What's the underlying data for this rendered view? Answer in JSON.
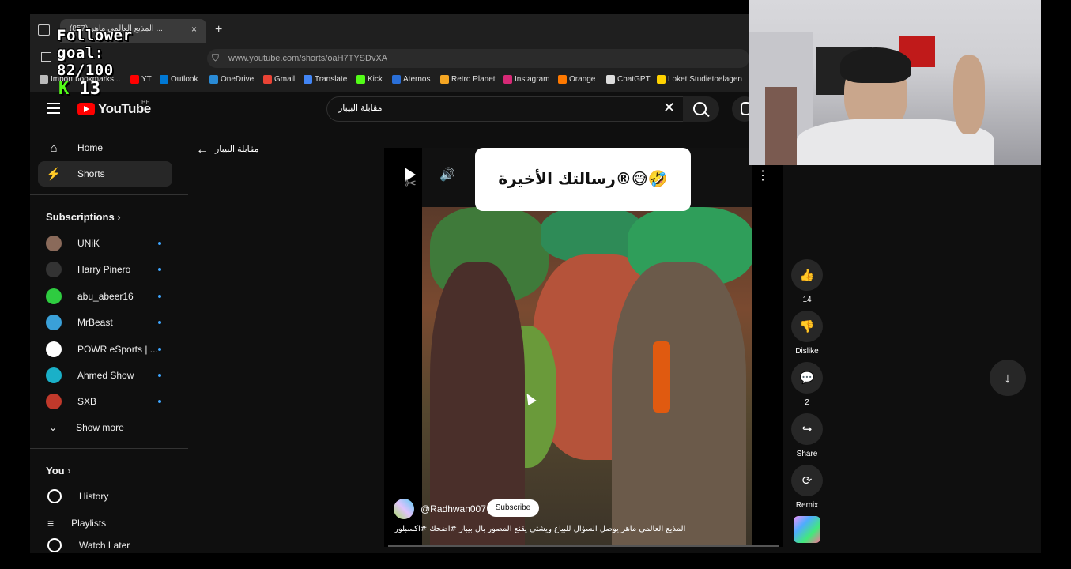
{
  "browser": {
    "tab_title": "(857) المذيع العالمي ماهر ...",
    "new_tab": "+",
    "tab_close": "×",
    "url": "www.youtube.com/shorts/oaH7TYSDvXA",
    "bookmarks": [
      {
        "label": "Import bookmarks...",
        "color": "#bbbbbb"
      },
      {
        "label": "YT",
        "color": "#ff0000"
      },
      {
        "label": "Outlook",
        "color": "#0078d4"
      },
      {
        "label": "OneDrive",
        "color": "#2a8bd6"
      },
      {
        "label": "Gmail",
        "color": "#ea4335"
      },
      {
        "label": "Translate",
        "color": "#4285f4"
      },
      {
        "label": "Kick",
        "color": "#53fc18"
      },
      {
        "label": "Aternos",
        "color": "#2a6fd8"
      },
      {
        "label": "Retro Planet",
        "color": "#f5a623"
      },
      {
        "label": "Instagram",
        "color": "#d62976"
      },
      {
        "label": "Orange",
        "color": "#ff7900"
      },
      {
        "label": "ChatGPT",
        "color": "#dddddd"
      },
      {
        "label": "Loket Studietoelagen",
        "color": "#ffd200"
      }
    ]
  },
  "overlay": {
    "follower_line1": "Follower",
    "follower_line2": "goal:",
    "follower_line3": "82/100",
    "kick_icon": "K",
    "kick_count": "13"
  },
  "header": {
    "logo_text": "YouTube",
    "region": "BE",
    "search_value": "مقابلة البيبار",
    "clear_icon": "✕"
  },
  "sidebar": {
    "nav": [
      {
        "label": "Home",
        "icon": "home-icon",
        "glyph": "⌂"
      },
      {
        "label": "Shorts",
        "icon": "shorts-icon",
        "glyph": "⚡"
      }
    ],
    "subscriptions_title": "Subscriptions",
    "subscriptions": [
      {
        "label": "UNiK",
        "color": "#8a6a5a"
      },
      {
        "label": "Harry Pinero",
        "color": "#333333"
      },
      {
        "label": "abu_abeer16",
        "color": "#2ecc40"
      },
      {
        "label": "MrBeast",
        "color": "#3aa0d8"
      },
      {
        "label": "POWR eSports | ...",
        "color": "#ffffff"
      },
      {
        "label": "Ahmed Show",
        "color": "#1ab0c8"
      },
      {
        "label": "SXB",
        "color": "#c0392b"
      }
    ],
    "show_more": "Show more",
    "you_title": "You",
    "you_items": [
      {
        "label": "History"
      },
      {
        "label": "Playlists"
      },
      {
        "label": "Watch Later"
      }
    ]
  },
  "shorts": {
    "query_label": "مقابلة البيبار",
    "caption": "رسالتك الأخيرة®😅🤣",
    "channel": "@Radhwan007",
    "subscribe": "Subscribe",
    "title": "المذيع العالمي ماهر يوصل السؤال للبياع ويشتي يقنع المصور بال بيبار #اضحك #اكسبلور",
    "actions": [
      {
        "name": "like",
        "glyph": "👍",
        "label": "14"
      },
      {
        "name": "dislike",
        "glyph": "👎",
        "label": "Dislike"
      },
      {
        "name": "comments",
        "glyph": "💬",
        "label": "2"
      },
      {
        "name": "share",
        "glyph": "↪",
        "label": "Share"
      },
      {
        "name": "remix",
        "glyph": "⟳",
        "label": "Remix"
      }
    ],
    "next_glyph": "↓"
  }
}
